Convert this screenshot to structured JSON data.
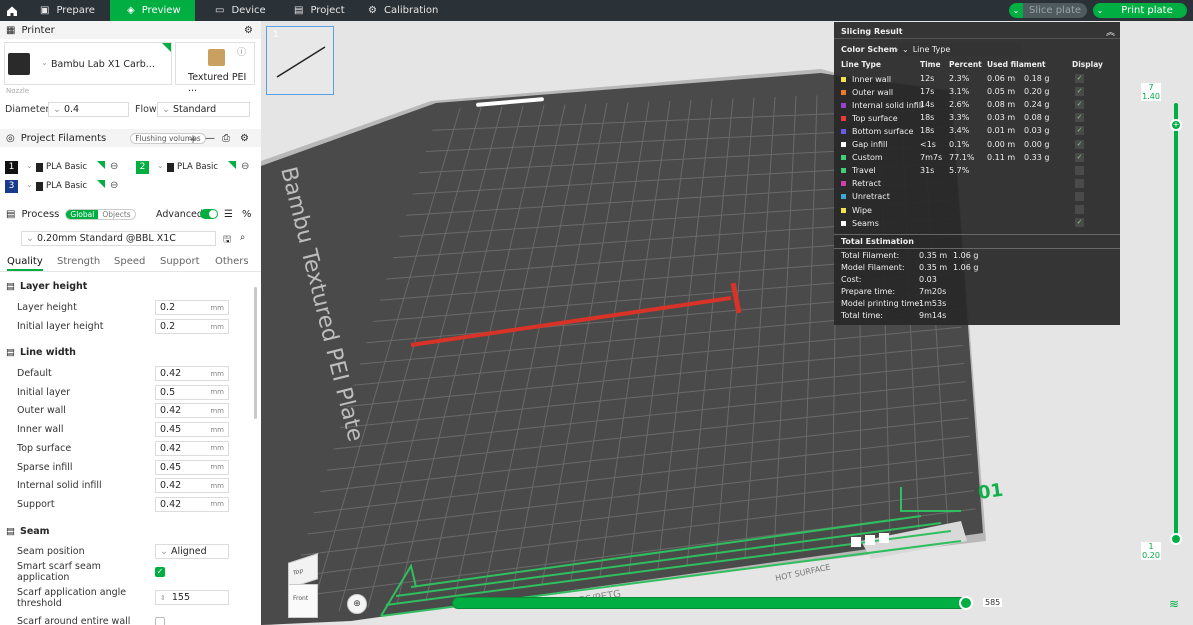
{
  "topbar": {
    "tabs": [
      "Prepare",
      "Preview",
      "Device",
      "Project",
      "Calibration"
    ],
    "slice": "Slice plate",
    "print": "Print plate"
  },
  "printer": {
    "title": "Printer",
    "name": "Bambu Lab X1 Carb...",
    "plate": "Textured PEI ...",
    "nozzle": "Nozzle",
    "diameter_label": "Diameter",
    "diameter": "0.4",
    "flow_label": "Flow",
    "flow": "Standard"
  },
  "filaments": {
    "title": "Project Filaments",
    "flush": "Flushing volumes",
    "items": [
      {
        "num": "1",
        "name": "PLA Basic",
        "color": "#111111"
      },
      {
        "num": "2",
        "name": "PLA Basic",
        "color": "#00ae42"
      },
      {
        "num": "3",
        "name": "PLA Basic",
        "color": "#1a3a8c"
      }
    ]
  },
  "process": {
    "title": "Process",
    "global": "Global",
    "objects": "Objects",
    "advanced": "Advanced",
    "preset": "0.20mm Standard @BBL X1C",
    "tabs": [
      "Quality",
      "Strength",
      "Speed",
      "Support",
      "Others"
    ]
  },
  "quality": {
    "layer_height": {
      "title": "Layer height",
      "rows": [
        {
          "label": "Layer height",
          "value": "0.2",
          "unit": "mm"
        },
        {
          "label": "Initial layer height",
          "value": "0.2",
          "unit": "mm"
        }
      ]
    },
    "line_width": {
      "title": "Line width",
      "rows": [
        {
          "label": "Default",
          "value": "0.42",
          "unit": "mm"
        },
        {
          "label": "Initial layer",
          "value": "0.5",
          "unit": "mm"
        },
        {
          "label": "Outer wall",
          "value": "0.42",
          "unit": "mm"
        },
        {
          "label": "Inner wall",
          "value": "0.45",
          "unit": "mm"
        },
        {
          "label": "Top surface",
          "value": "0.42",
          "unit": "mm"
        },
        {
          "label": "Sparse infill",
          "value": "0.45",
          "unit": "mm"
        },
        {
          "label": "Internal solid infill",
          "value": "0.42",
          "unit": "mm"
        },
        {
          "label": "Support",
          "value": "0.42",
          "unit": "mm"
        }
      ]
    },
    "seam": {
      "title": "Seam",
      "position_label": "Seam position",
      "position": "Aligned",
      "smart": "Smart scarf seam application",
      "angle_label": "Scarf application angle threshold",
      "angle": "155",
      "around": "Scarf around entire wall"
    }
  },
  "plate": {
    "number": "1",
    "bed_text": "Bambu Textured PEI Plate",
    "index": "01",
    "hot": "HOT SURFACE",
    "materials": "PLA/ABS/PETG"
  },
  "viewcube": {
    "top": "Top",
    "front": "Front"
  },
  "slicing": {
    "title": "Slicing Result",
    "scheme_label": "Color Scheme",
    "scheme": "Line Type",
    "headers": [
      "Line Type",
      "Time",
      "Percent",
      "Used filament",
      "Display"
    ],
    "rows": [
      {
        "name": "Inner wall",
        "time": "12s",
        "pct": "2.3%",
        "m": "0.06 m",
        "g": "0.18 g",
        "color": "#f2e24b",
        "on": true
      },
      {
        "name": "Outer wall",
        "time": "17s",
        "pct": "3.1%",
        "m": "0.05 m",
        "g": "0.20 g",
        "color": "#f07a2b",
        "on": true
      },
      {
        "name": "Internal solid infill",
        "time": "14s",
        "pct": "2.6%",
        "m": "0.08 m",
        "g": "0.24 g",
        "color": "#9a3fd1",
        "on": true
      },
      {
        "name": "Top surface",
        "time": "18s",
        "pct": "3.3%",
        "m": "0.03 m",
        "g": "0.08 g",
        "color": "#e83a3a",
        "on": true
      },
      {
        "name": "Bottom surface",
        "time": "18s",
        "pct": "3.4%",
        "m": "0.01 m",
        "g": "0.03 g",
        "color": "#6a5ae8",
        "on": true
      },
      {
        "name": "Gap infill",
        "time": "<1s",
        "pct": "0.1%",
        "m": "0.00 m",
        "g": "0.00 g",
        "color": "#ffffff",
        "on": true
      },
      {
        "name": "Custom",
        "time": "7m7s",
        "pct": "77.1%",
        "m": "0.11 m",
        "g": "0.33 g",
        "color": "#3fd17a",
        "on": true
      },
      {
        "name": "Travel",
        "time": "31s",
        "pct": "5.7%",
        "m": "",
        "g": "",
        "color": "#3fd17a",
        "on": false
      },
      {
        "name": "Retract",
        "time": "",
        "pct": "",
        "m": "",
        "g": "",
        "color": "#d13fa8",
        "on": false
      },
      {
        "name": "Unretract",
        "time": "",
        "pct": "",
        "m": "",
        "g": "",
        "color": "#3fa8d1",
        "on": false
      },
      {
        "name": "Wipe",
        "time": "",
        "pct": "",
        "m": "",
        "g": "",
        "color": "#f2e24b",
        "on": false
      },
      {
        "name": "Seams",
        "time": "",
        "pct": "",
        "m": "",
        "g": "",
        "color": "#ffffff",
        "on": true
      }
    ],
    "estimation_title": "Total Estimation",
    "estimation": [
      {
        "label": "Total Filament:",
        "a": "0.35 m",
        "b": "1.06 g"
      },
      {
        "label": "Model Filament:",
        "a": "0.35 m",
        "b": "1.06 g"
      },
      {
        "label": "Cost:",
        "a": "0.03",
        "b": ""
      },
      {
        "label": "Prepare time:",
        "a": "7m20s",
        "b": ""
      },
      {
        "label": "Model printing time:",
        "a": "1m53s",
        "b": ""
      },
      {
        "label": "Total time:",
        "a": "9m14s",
        "b": ""
      }
    ]
  },
  "layer_slider": {
    "top_layer": "7",
    "top_height": "1.40",
    "bottom_layer": "1",
    "bottom_height": "0.20",
    "top_fraction": 1.0,
    "bottom_fraction": 0.0
  },
  "move_slider": {
    "value": "585",
    "fraction": 1.0
  },
  "accent": "#00ae42"
}
